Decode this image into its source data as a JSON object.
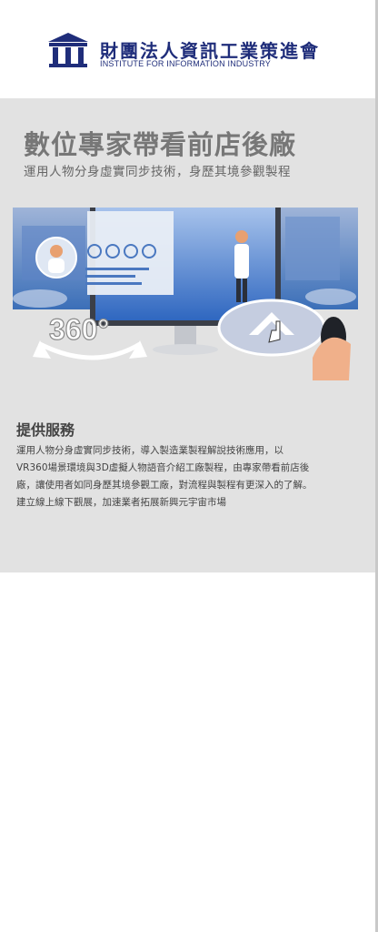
{
  "header": {
    "org_name_cn": "財團法人資訊工業策進會",
    "org_name_en": "INSTITUTE FOR INFORMATION INDUSTRY",
    "logo_icon": "institute-building-logo",
    "brand_color": "#1f2d7a"
  },
  "hero": {
    "title": "數位專家帶看前店後廠",
    "subtitle": "運用人物分身虛實同步技術，身歷其境參觀製程",
    "badge_360": "360°",
    "panel_color": "#e2e2e2"
  },
  "services": {
    "heading": "提供服務",
    "lines": [
      "運用人物分身虛實同步技術，導入製造業製程解說技術應用，以",
      "VR360場景環境與3D虛擬人物語音介紹工廠製程，由專家帶看前店後",
      "廠，讓使用者如同身歷其境參觀工廠，對流程與製程有更深入的了解。",
      "建立線上線下觀展，加速業者拓展新興元宇宙市場"
    ]
  }
}
